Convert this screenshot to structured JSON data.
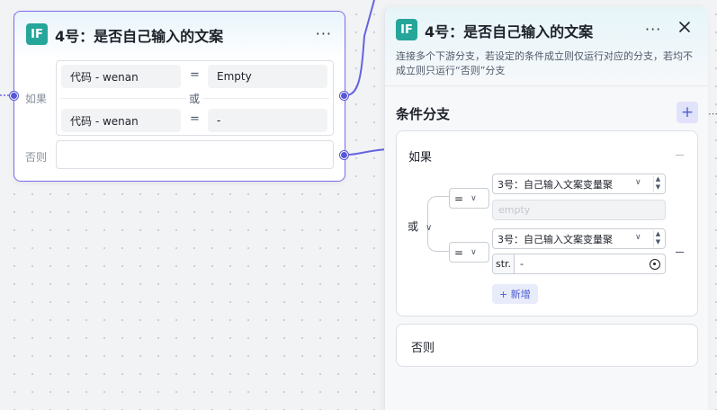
{
  "node": {
    "icon": "IF",
    "title": "4号：是否自己输入的文案",
    "more": "···",
    "if_label": "如果",
    "else_label": "否则",
    "or_label": "或",
    "conditions": [
      {
        "var": "代码 - wenan",
        "op": "=",
        "value": "Empty"
      },
      {
        "var": "代码 - wenan",
        "op": "=",
        "value": "-"
      }
    ]
  },
  "panel": {
    "icon": "IF",
    "title": "4号：是否自己输入的文案",
    "more": "···",
    "close_icon": "close-icon",
    "description": "连接多个下游分支，若设定的条件成立则仅运行对应的分支，若均不成立则只运行“否则”分支",
    "section_title": "条件分支",
    "add_branch": "+",
    "branch": {
      "label": "如果",
      "logic": "或",
      "conditions": [
        {
          "op": "=",
          "var": "3号：自己输入文案变量聚",
          "value_placeholder": "empty",
          "value": ""
        },
        {
          "op": "=",
          "var": "3号：自己输入文案变量聚",
          "value_type": "str.",
          "value": "-"
        }
      ],
      "add_condition": "+ 新增"
    },
    "else_label": "否则"
  },
  "sliver": "⋯"
}
